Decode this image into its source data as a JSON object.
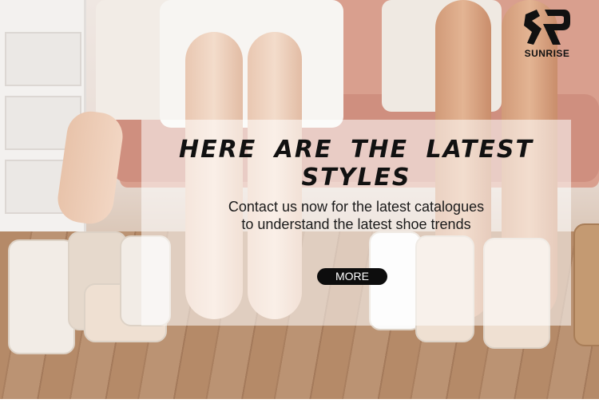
{
  "brand": {
    "logo_mark": "SP",
    "name": "SUNRISE"
  },
  "banner": {
    "headline": "HERE ARE THE LATEST STYLES",
    "subtext_line1": "Contact us now for the latest catalogues",
    "subtext_line2": "to understand the latest shoe trends",
    "button_label": "MORE"
  },
  "colors": {
    "button_bg": "#0d0d0d",
    "button_text": "#ffffff",
    "headline": "#111111",
    "overlay": "rgba(255,255,255,0.55)"
  },
  "icons": {
    "logo": "sunrise-logo-icon"
  }
}
